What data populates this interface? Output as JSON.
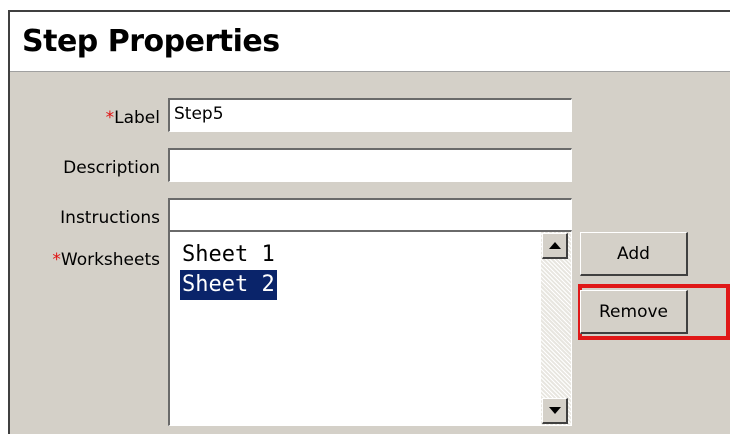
{
  "panel": {
    "title": "Step Properties"
  },
  "form": {
    "required_marker": "*",
    "label_field": {
      "label": "Label",
      "value": "Step5"
    },
    "description_field": {
      "label": "Description",
      "value": ""
    },
    "instructions_field": {
      "label": "Instructions",
      "value": ""
    },
    "worksheets": {
      "label": "Worksheets",
      "items": [
        {
          "text": "Sheet 1",
          "selected": false
        },
        {
          "text": "Sheet 2",
          "selected": true
        }
      ]
    }
  },
  "buttons": {
    "add": "Add",
    "remove": "Remove"
  },
  "colors": {
    "required": "#e01010",
    "selection": "#0a246a",
    "highlight": "#e01818",
    "panel_bg": "#d4d0c8"
  }
}
